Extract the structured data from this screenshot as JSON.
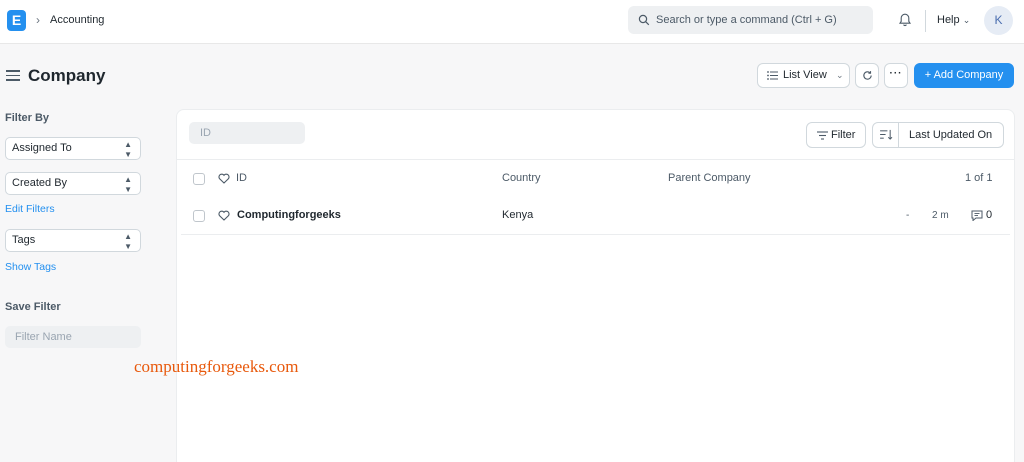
{
  "navbar": {
    "logo_letter": "E",
    "breadcrumb": "Accounting",
    "search_placeholder": "Search or type a command (Ctrl + G)",
    "help_label": "Help",
    "avatar_initial": "K"
  },
  "page": {
    "title": "Company",
    "list_view_label": "List View",
    "more_label": "···",
    "add_label": "+ Add Company"
  },
  "sidebar": {
    "filter_by_heading": "Filter By",
    "assigned_to": "Assigned To",
    "created_by": "Created By",
    "edit_filters": "Edit Filters",
    "tags": "Tags",
    "show_tags": "Show Tags",
    "save_filter_heading": "Save Filter",
    "filter_name_placeholder": "Filter Name"
  },
  "list": {
    "id_filter_placeholder": "ID",
    "filter_label": "Filter",
    "sort_label": "Last Updated On",
    "columns": {
      "id": "ID",
      "country": "Country",
      "parent_company": "Parent Company",
      "count": "1 of 1"
    },
    "rows": [
      {
        "name": "Computingforgeeks",
        "country": "Kenya",
        "parent": "-",
        "modified": "2 m",
        "comments": "0"
      }
    ]
  },
  "watermark": "computingforgeeks.com",
  "colors": {
    "primary": "#2490ef",
    "watermark": "#e8590c"
  }
}
